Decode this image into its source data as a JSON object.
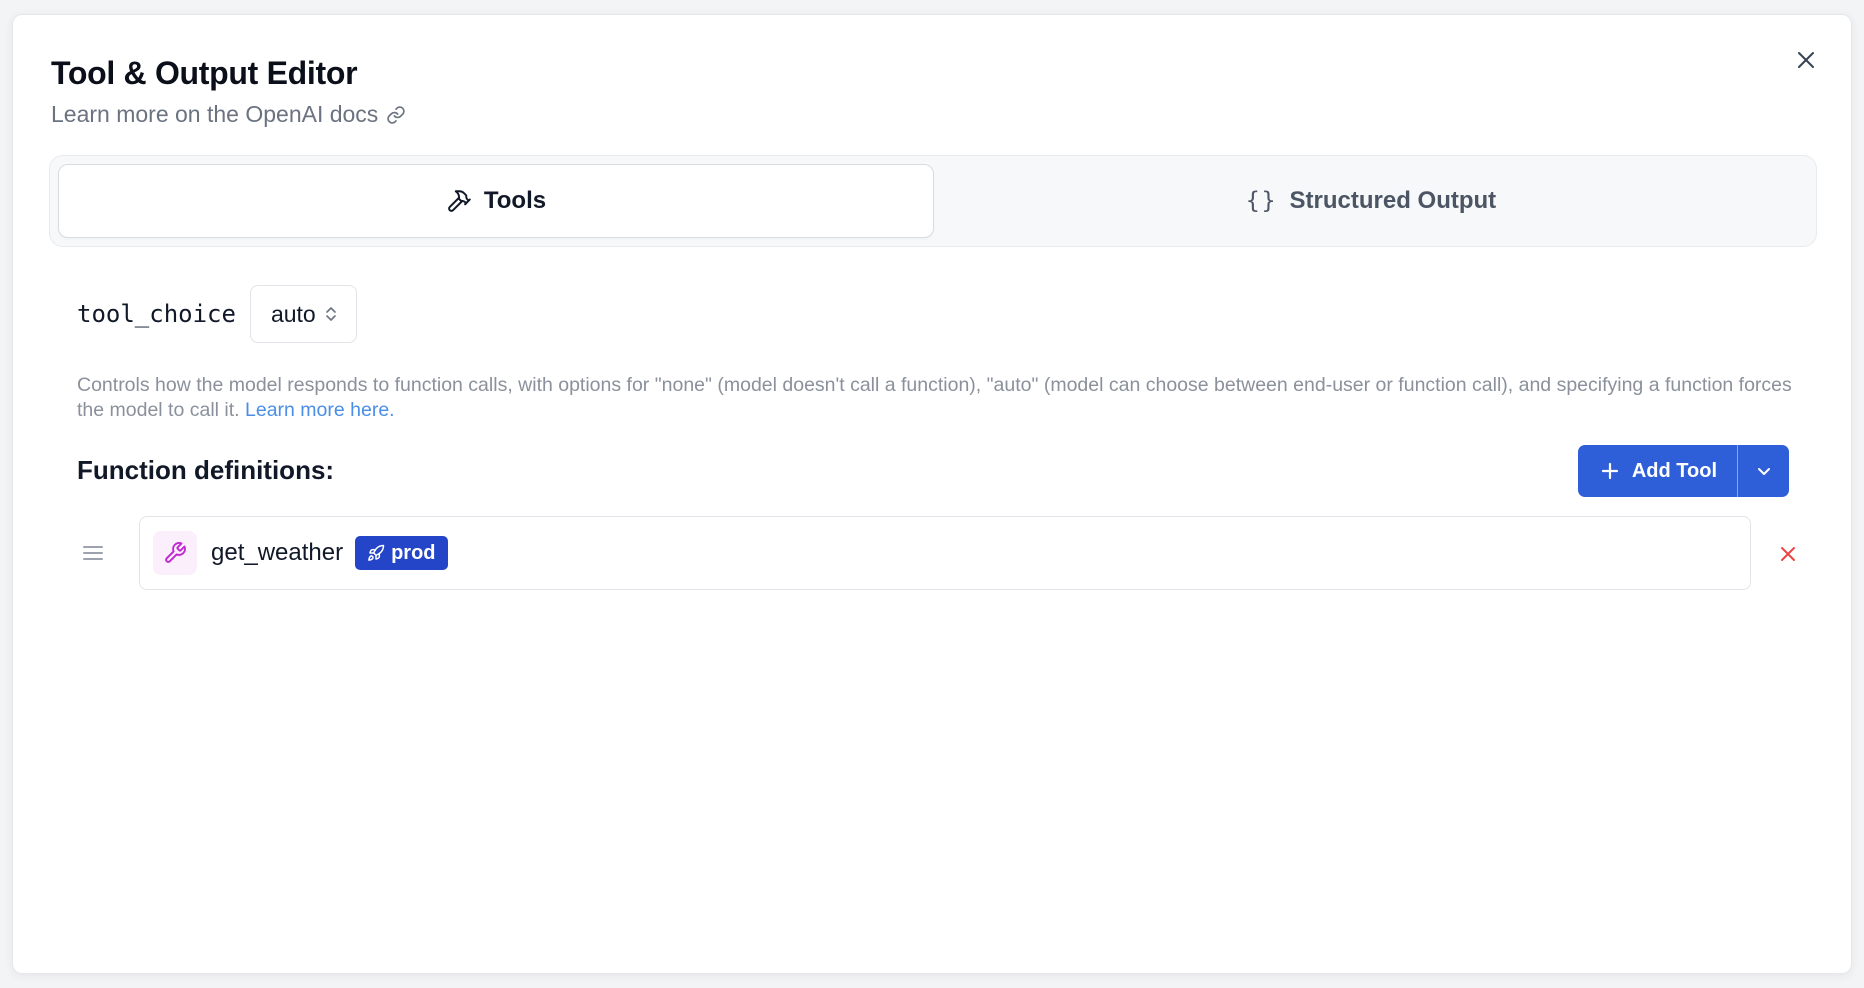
{
  "dialog": {
    "title": "Tool & Output Editor",
    "docs_link": "Learn more on the OpenAI docs",
    "close_icon": "close-icon"
  },
  "tabs": [
    {
      "label": "Tools",
      "icon": "hammer-icon",
      "active": true
    },
    {
      "label": "Structured Output",
      "icon": "braces-icon",
      "active": false
    }
  ],
  "tool_choice": {
    "label": "tool_choice",
    "value": "auto"
  },
  "help": {
    "text": "Controls how the model responds to function calls, with options for \"none\" (model doesn't call a function), \"auto\" (model can choose between end-user or function call), and specifying a function forces the model to call it.",
    "link": "Learn more here."
  },
  "functions": {
    "heading": "Function definitions:",
    "add_label": "Add Tool",
    "items": [
      {
        "name": "get_weather",
        "badge": "prod",
        "icon": "wrench-icon",
        "badge_icon": "rocket-icon"
      }
    ]
  },
  "colors": {
    "primary": "#2f5fd8",
    "badge": "#2445c7",
    "link": "#4a8ee6",
    "danger": "#ef4444",
    "wrench": "#c026d3"
  }
}
